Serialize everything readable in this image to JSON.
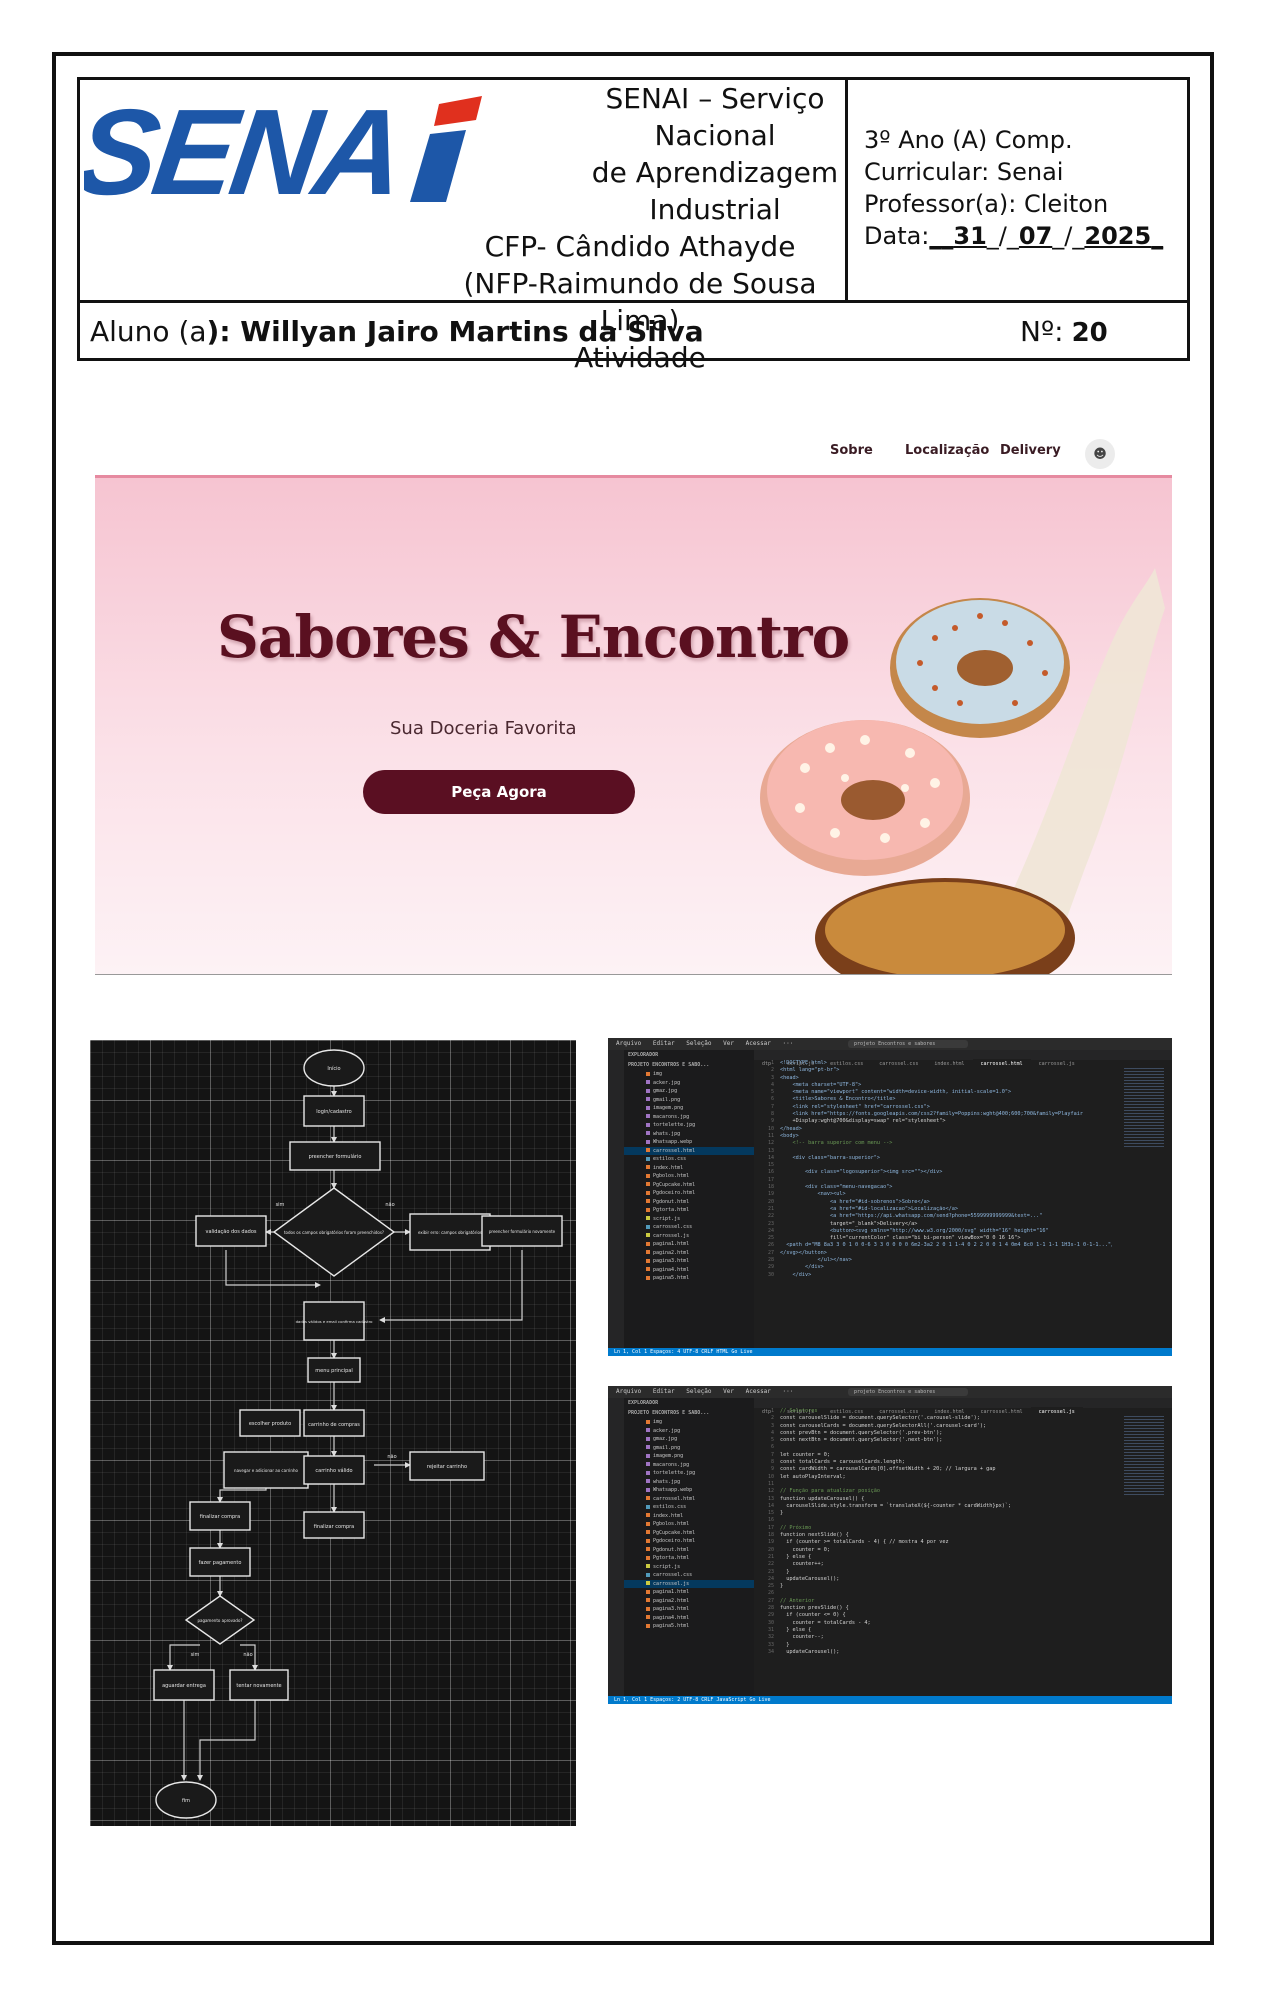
{
  "header": {
    "institution_lines": [
      "SENAI – Serviço Nacional",
      "de Aprendizagem",
      "Industrial",
      "CFP- Cândido Athayde",
      "(NFP-Raimundo de Sousa Lima)",
      "Atividade"
    ],
    "logo_text": "SENAI",
    "grade": "3º Ano (A) Comp.",
    "curriculum": "Curricular: Senai",
    "teacher": "Professor(a): Cleiton",
    "date_label": "Data:",
    "date_day": "31",
    "date_month": "07",
    "date_year": "2025",
    "student_label": "Aluno (a",
    "student_name": "): Willyan Jairo Martins da Silva",
    "number_label": "Nº:",
    "number_value": "20"
  },
  "website": {
    "nav": [
      "Sobre",
      "Localização",
      "Delivery"
    ],
    "title": "Sabores & Encontro",
    "subtitle": "Sua Doceria Favorita",
    "cta": "Peça Agora"
  },
  "flowchart": {
    "nodes": {
      "start": "Início",
      "login": "login/cadastro",
      "form": "preencher formulário",
      "decision1": "todos os campos obrigatórios foram preenchidos?",
      "ok": "validação dos dados",
      "not_ok": "exibir erro: campos obrigatórios",
      "fill_again": "preencher formulário novamente",
      "save": "dados válidos e email confirma cadastro",
      "menu": "menu principal",
      "choose": "escolher produto",
      "cart": "carrinho de compras",
      "add": "navegar e adicionar ao carrinho",
      "cart_ok": "carrinho válido",
      "reject": "rejeitar carrinho",
      "finish": "finalizar compra",
      "pay": "fazer pagamento",
      "decision2": "pagamento aprovado?",
      "delivery": "aguardar entrega",
      "redo": "tentar novamente",
      "end": "fim"
    },
    "labels": {
      "yes": "sim",
      "no": "não"
    }
  },
  "editor1": {
    "menu": [
      "Arquivo",
      "Editar",
      "Seleção",
      "Ver",
      "Acessar",
      "···"
    ],
    "search": "projeto Encontros e sabores",
    "explorer": "EXPLORADOR",
    "project": "PROJETO ENCONTROS E SABO...",
    "files": [
      "img",
      "acker.jpg",
      "gmaz.jpg",
      "gmail.png",
      "imagem.png",
      "macarons.jpg",
      "tortelette.jpg",
      "whats.jpg",
      "Whatsapp.webp",
      "carrossel.html",
      "estilos.css",
      "index.html",
      "Pgbolos.html",
      "PgCupcake.html",
      "Pgdoceiro.html",
      "Pgdonut.html",
      "Pgtorta.html",
      "script.js",
      "carrossel.css",
      "carrossel.js",
      "pagina1.html",
      "pagina2.html",
      "pagina3.html",
      "pagina4.html",
      "pagina5.html"
    ],
    "selected_file": "carrossel.html",
    "tabs": [
      "dtp",
      "script.js",
      "estilos.css",
      "carrossel.css",
      "index.html",
      "carrossel.html",
      "carrossel.js"
    ],
    "status": "Ln 1, Col 1   Espaços: 4   UTF-8   CRLF   HTML   Go Live",
    "code": [
      "<!DOCTYPE html>",
      "<html lang=\"pt-br\">",
      "<head>",
      "    <meta charset=\"UTF-8\">",
      "    <meta name=\"viewport\" content=\"width=device-width, initial-scale=1.0\">",
      "    <title>Sabores & Encontro</title>",
      "    <link rel=\"stylesheet\" href=\"carrossel.css\">",
      "    <link href=\"https://fonts.googleapis.com/css2?family=Poppins:wght@400;600;700&family=Playfair",
      "    +Display:wght@700&display=swap\" rel=\"stylesheet\">",
      "</head>",
      "<body>",
      "    <!-- barra superior com menu -->",
      "",
      "    <div class=\"barra-superior\">",
      "",
      "        <div class=\"logosuperior\"><img src=\"\"></div>",
      "",
      "        <div class=\"menu-navegacao\">",
      "            <nav><ul>",
      "                <a href=\"#id-sobrenos\">Sobre</a>",
      "                <a href=\"#id-localizacao\">Localização</a>",
      "                <a href=\"https://api.whatsapp.com/send?phone=5599999999999&text=...\"",
      "                target=\"_blank\">Delivery</a>",
      "                <button><svg xmlns=\"http://www.w3.org/2000/svg\" width=\"16\" height=\"16\"",
      "                fill=\"currentColor\" class=\"bi bi-person\" viewBox=\"0 0 16 16\">",
      "  <path d=\"M8 8a3 3 0 1 0 0-6 3 3 0 0 0 0 6m2-3a2 2 0 1 1-4 0 2 2 0 0 1 4 0m4 8c0 1-1 1-1 1H3s-1 0-1-1...\"/>",
      "</svg></button>",
      "            </ul></nav>",
      "        </div>",
      "    </div>"
    ]
  },
  "editor2": {
    "selected_file": "carrossel.js",
    "status": "Ln 1, Col 1   Espaços: 2   UTF-8   CRLF   JavaScript   Go Live",
    "code": [
      "// Seletores",
      "const carouselSlide = document.querySelector('.carousel-slide');",
      "const carouselCards = document.querySelectorAll('.carousel-card');",
      "const prevBtn = document.querySelector('.prev-btn');",
      "const nextBtn = document.querySelector('.next-btn');",
      "",
      "let counter = 0;",
      "const totalCards = carouselCards.length;",
      "const cardWidth = carouselCards[0].offsetWidth + 20; // largura + gap",
      "let autoPlayInterval;",
      "",
      "// Função para atualizar posição",
      "function updateCarousel() {",
      "  carouselSlide.style.transform = `translateX(${-counter * cardWidth}px)`;",
      "}",
      "",
      "// Próximo",
      "function nextSlide() {",
      "  if (counter >= totalCards - 4) { // mostra 4 por vez",
      "    counter = 0;",
      "  } else {",
      "    counter++;",
      "  }",
      "  updateCarousel();",
      "}",
      "",
      "// Anterior",
      "function prevSlide() {",
      "  if (counter <= 0) {",
      "    counter = totalCards - 4;",
      "  } else {",
      "    counter--;",
      "  }",
      "  updateCarousel();"
    ]
  }
}
